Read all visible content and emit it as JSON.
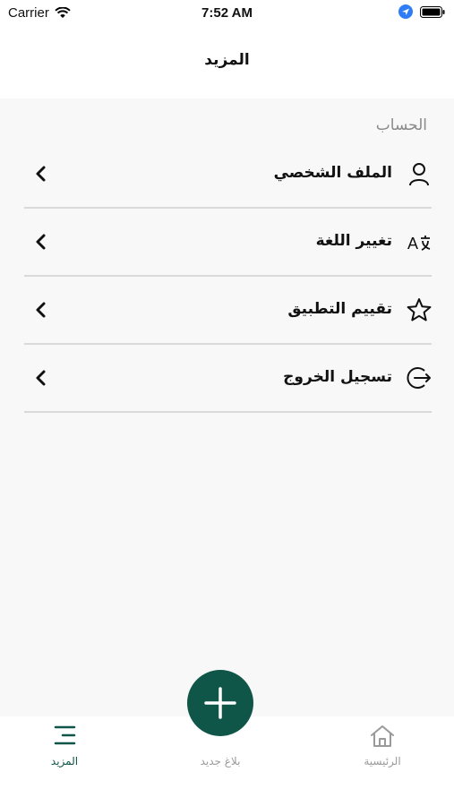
{
  "status_bar": {
    "carrier": "Carrier",
    "time": "7:52 AM"
  },
  "header": {
    "title": "المزيد"
  },
  "account_section": {
    "title": "الحساب",
    "items": [
      {
        "label": "الملف الشخصي",
        "icon": "user-icon"
      },
      {
        "label": "تغيير اللغة",
        "icon": "translate-icon"
      },
      {
        "label": "تقييم التطبيق",
        "icon": "star-icon"
      },
      {
        "label": "تسجيل الخروج",
        "icon": "logout-icon"
      }
    ]
  },
  "tab_bar": {
    "tabs": [
      {
        "label": "المزيد",
        "icon": "menu-icon",
        "active": true
      },
      {
        "label": "بلاغ جديد",
        "icon": "plus-icon",
        "active": false
      },
      {
        "label": "الرئيسية",
        "icon": "home-icon",
        "active": false
      }
    ]
  },
  "colors": {
    "accent": "#0f5548",
    "inactive": "#9a9a9a"
  }
}
